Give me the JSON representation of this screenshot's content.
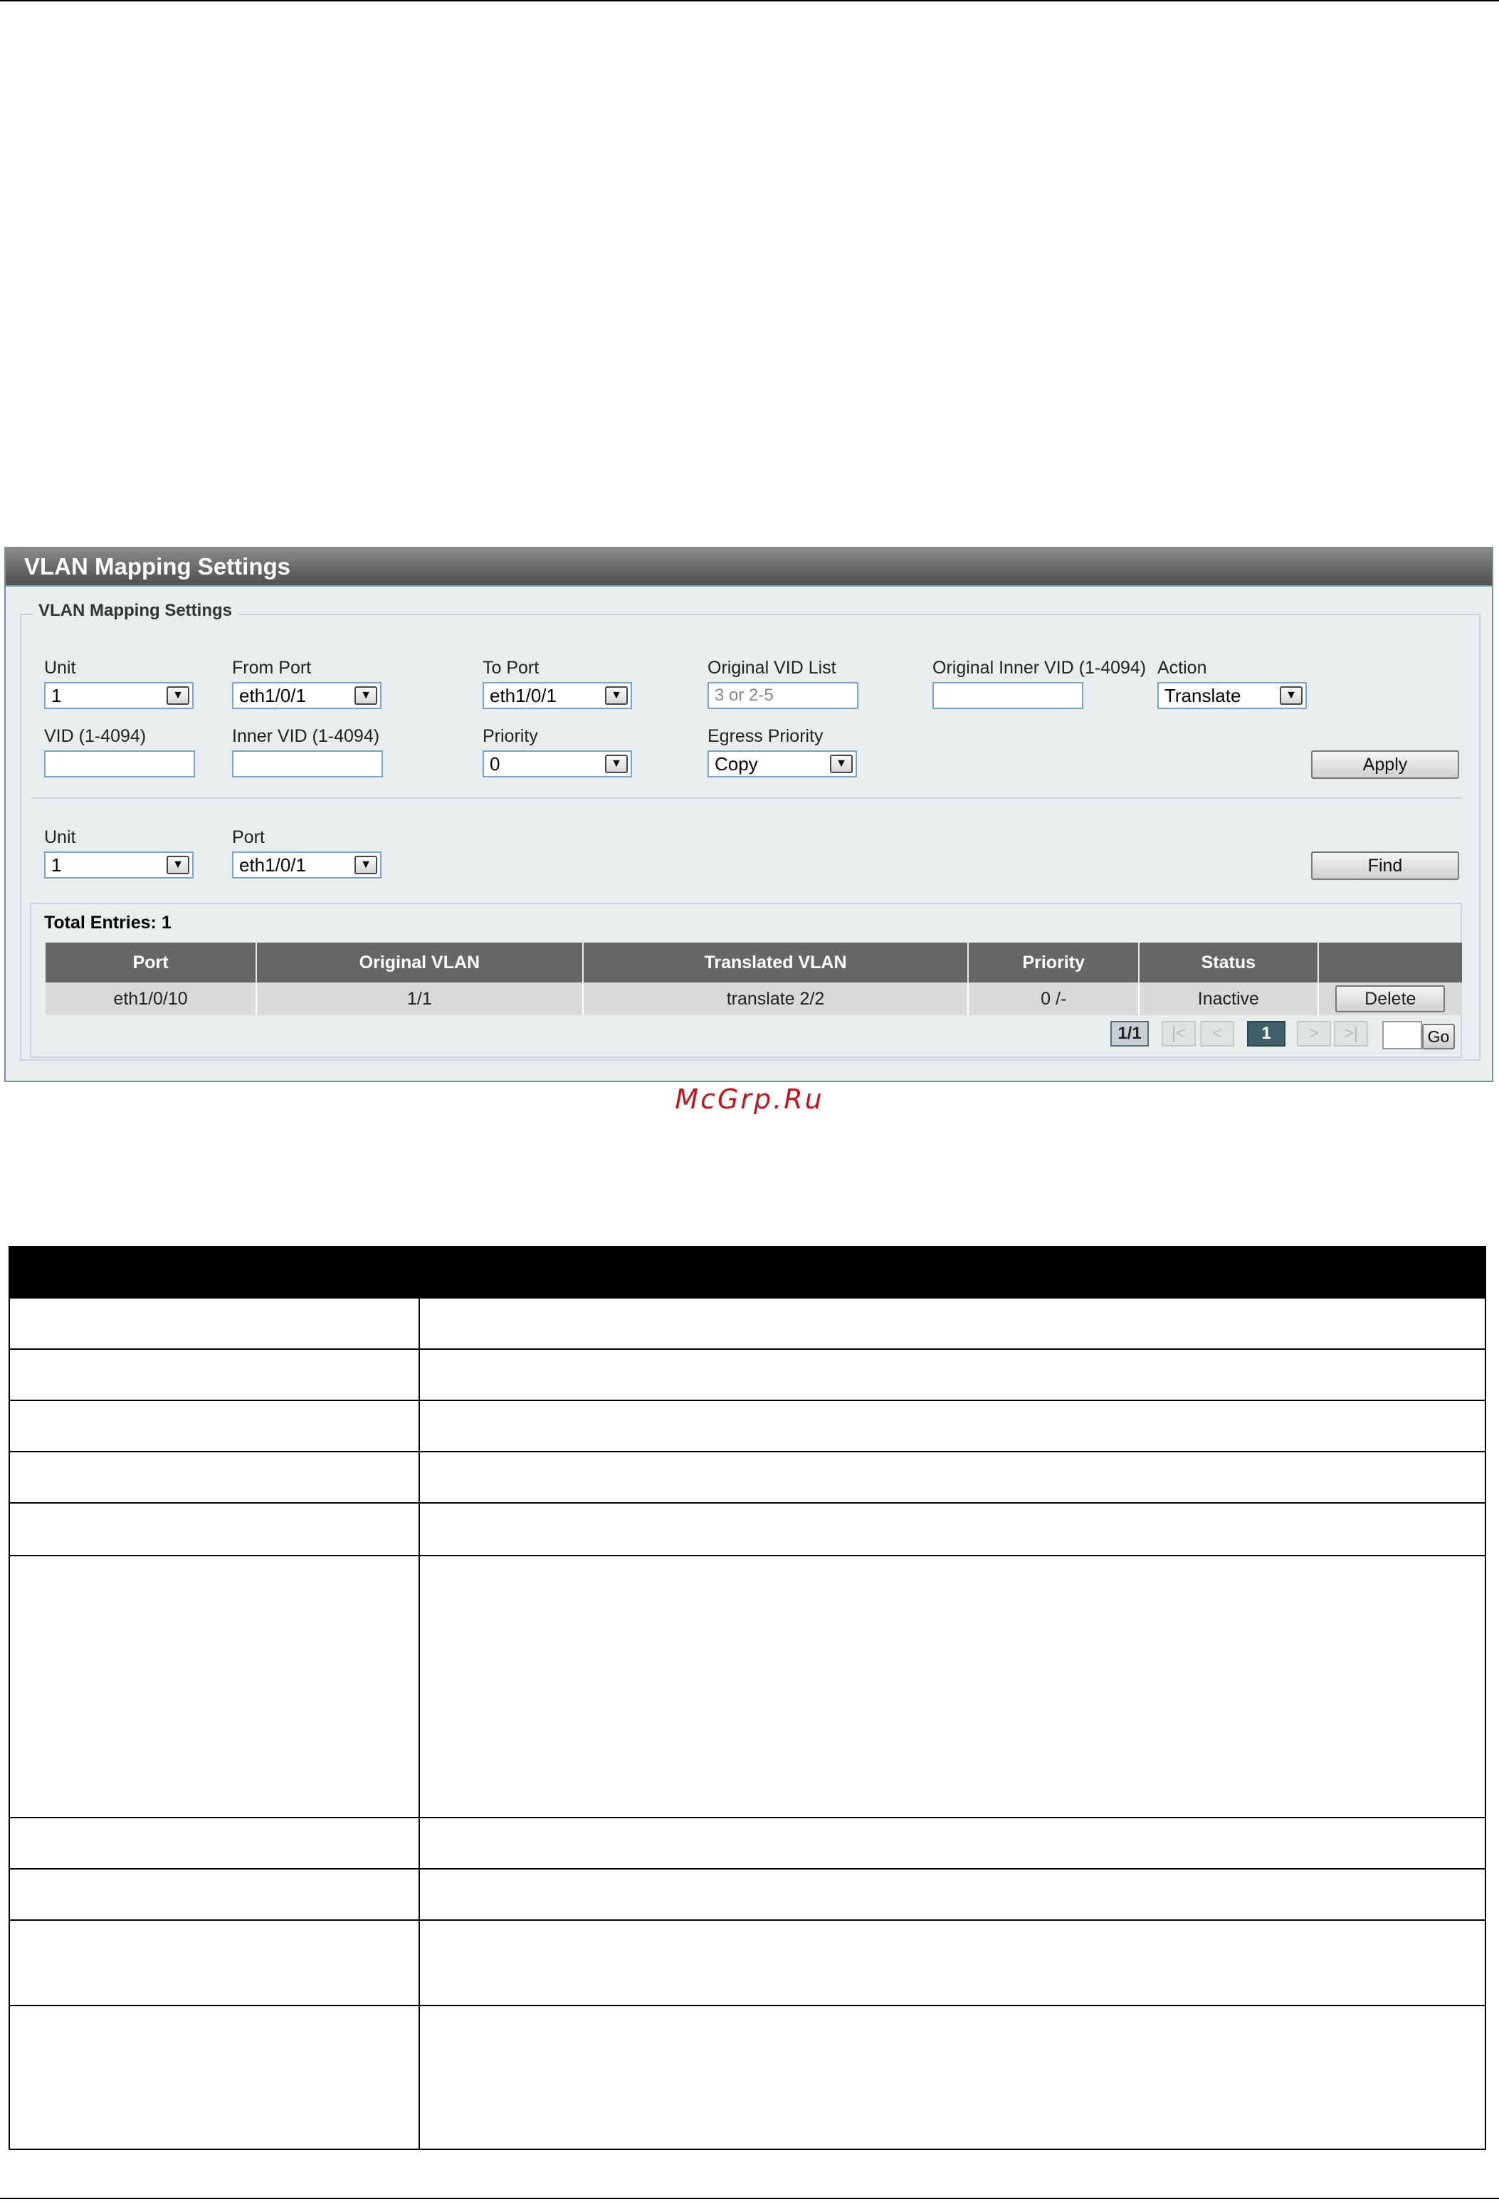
{
  "watermark": "McGrp.Ru",
  "panel": {
    "title": "VLAN Mapping Settings",
    "legend": "VLAN Mapping Settings",
    "form": {
      "unit_label": "Unit",
      "unit_value": "1",
      "from_port_label": "From Port",
      "from_port_value": "eth1/0/1",
      "to_port_label": "To Port",
      "to_port_value": "eth1/0/1",
      "original_vid_list_label": "Original VID List",
      "original_vid_list_placeholder": "3 or 2-5",
      "original_inner_vid_label": "Original Inner VID (1-4094)",
      "original_inner_vid_value": "",
      "action_label": "Action",
      "action_value": "Translate",
      "vid_label": "VID (1-4094)",
      "vid_value": "",
      "inner_vid_label": "Inner VID (1-4094)",
      "inner_vid_value": "",
      "priority_label": "Priority",
      "priority_value": "0",
      "egress_priority_label": "Egress Priority",
      "egress_priority_value": "Copy",
      "apply_label": "Apply"
    },
    "find": {
      "unit_label": "Unit",
      "unit_value": "1",
      "port_label": "Port",
      "port_value": "eth1/0/1",
      "find_label": "Find"
    },
    "results": {
      "total_entries": "Total Entries: 1",
      "columns": [
        "Port",
        "Original VLAN",
        "Translated VLAN",
        "Priority",
        "Status",
        ""
      ],
      "rows": [
        {
          "port": "eth1/0/10",
          "original_vlan": "1/1",
          "translated_vlan": "translate 2/2",
          "priority": "0 /-",
          "status": "Inactive",
          "action": "Delete"
        }
      ]
    },
    "pagination": {
      "page_info": "1/1",
      "first": "|<",
      "prev": "<",
      "current": "1",
      "next": ">",
      "last": ">|",
      "go_value": "",
      "go_label": "Go"
    }
  },
  "colors": {
    "panel_bg": "#e8edee",
    "header_bg": "#5a5a5a",
    "table_header": "#666666",
    "current_page": "#3f5f6b",
    "watermark": "#c0171f"
  }
}
